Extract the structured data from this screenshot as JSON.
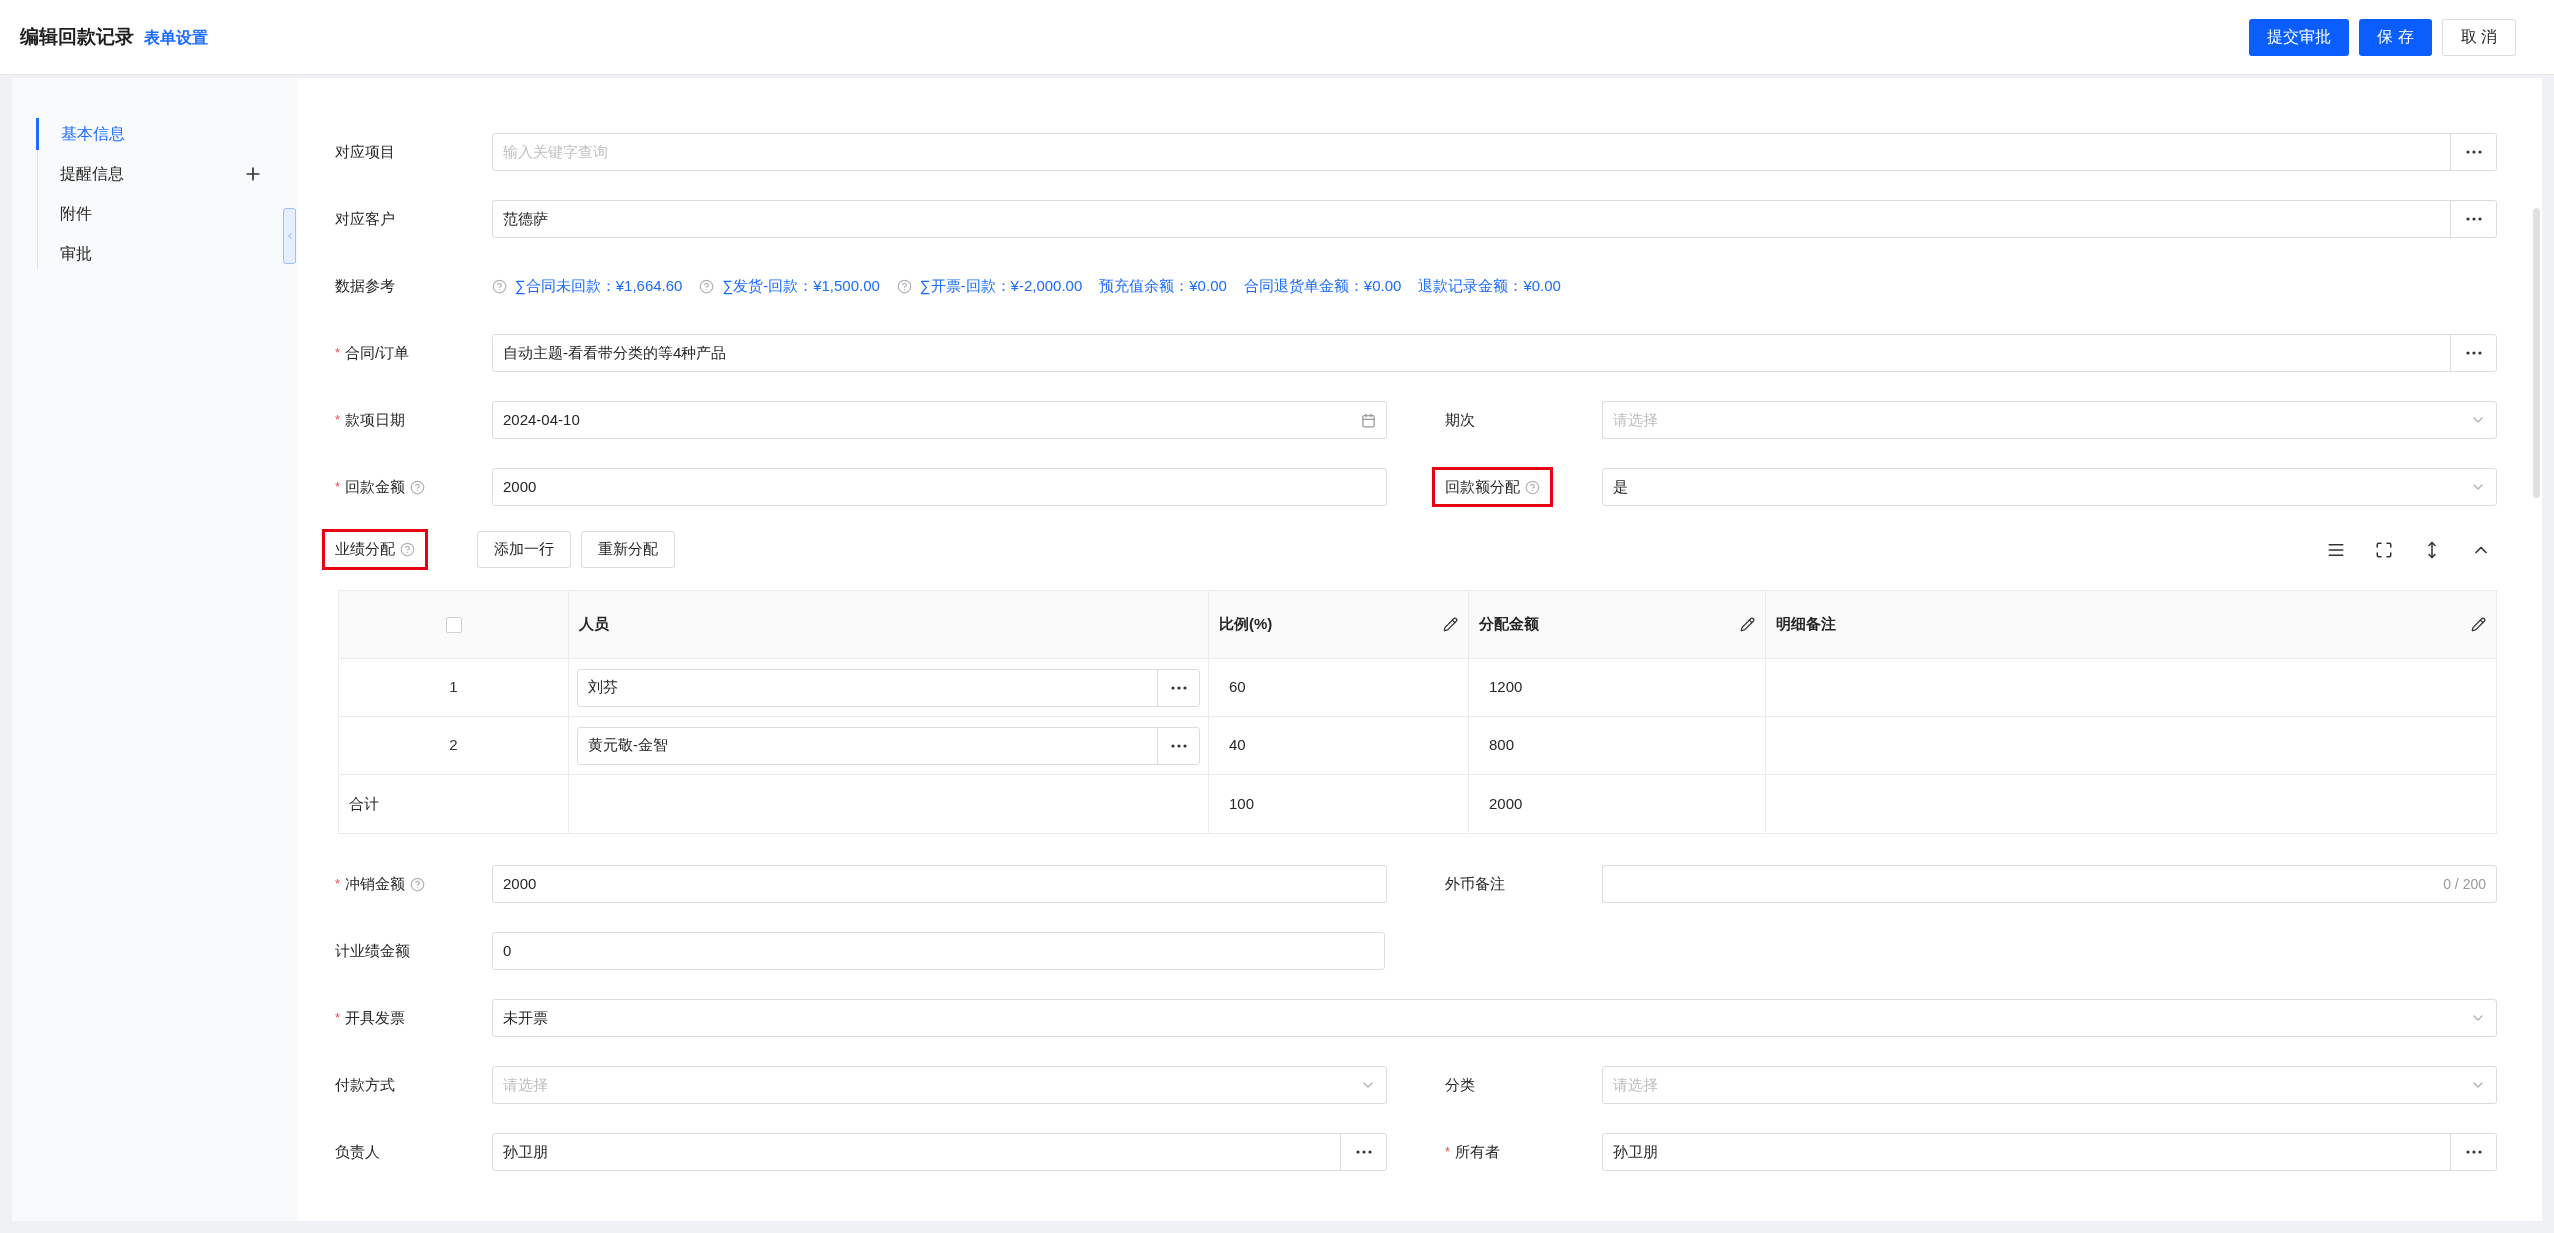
{
  "header": {
    "title": "编辑回款记录",
    "link": "表单设置",
    "buttons": [
      {
        "label": "提交审批",
        "kind": "primary"
      },
      {
        "label": "保 存",
        "kind": "primary"
      },
      {
        "label": "取 消",
        "kind": "default"
      }
    ]
  },
  "sidebar": {
    "items": [
      {
        "label": "基本信息",
        "selected": true,
        "addable": false
      },
      {
        "label": "提醒信息",
        "selected": false,
        "addable": true
      },
      {
        "label": "附件",
        "selected": false,
        "addable": false
      },
      {
        "label": "审批",
        "selected": false,
        "addable": false
      }
    ]
  },
  "form_top": [
    {
      "kind": "full",
      "fields": [
        {
          "label": "对应项目",
          "kind": "lookup",
          "placeholder": "输入关键字查询"
        }
      ]
    },
    {
      "kind": "full",
      "fields": [
        {
          "label": "对应客户",
          "kind": "lookup",
          "value": "范德萨"
        }
      ]
    },
    {
      "kind": "refs",
      "label": "数据参考",
      "refs": [
        {
          "text": "∑合同未回款：¥1,664.60",
          "help": true
        },
        {
          "text": "∑发货-回款：¥1,500.00",
          "help": true
        },
        {
          "text": "∑开票-回款：¥-2,000.00",
          "help": true
        },
        {
          "text": "预充值余额：¥0.00",
          "help": false
        },
        {
          "text": "合同退货单金额：¥0.00",
          "help": false
        },
        {
          "text": "退款记录金额：¥0.00",
          "help": false
        }
      ]
    },
    {
      "kind": "full",
      "fields": [
        {
          "label": "合同/订单",
          "required_mark": "*",
          "kind": "lookup",
          "value": "自动主题-看看带分类的等4种产品"
        }
      ]
    },
    {
      "kind": "split",
      "fields": [
        {
          "label": "款项日期",
          "required_mark": "*",
          "kind": "date",
          "value": "2024-04-10"
        },
        {
          "label": "期次",
          "kind": "select",
          "placeholder": "请选择"
        }
      ]
    },
    {
      "kind": "split",
      "fields": [
        {
          "label": "回款金额",
          "required_mark": "*",
          "help": true,
          "kind": "text",
          "value": "2000"
        },
        {
          "label": "回款额分配",
          "help": true,
          "highlighted": true,
          "kind": "select",
          "value": "是"
        }
      ]
    }
  ],
  "allocation": {
    "label": "业绩分配",
    "help": true,
    "highlighted": true,
    "buttons": [
      "添加一行",
      "重新分配"
    ],
    "table": {
      "select_all_checked": false,
      "columns": [
        {
          "label": "人员",
          "editable": false
        },
        {
          "label": "比例(%)",
          "editable": true
        },
        {
          "label": "分配金额",
          "editable": true
        },
        {
          "label": "明细备注",
          "editable": true
        }
      ],
      "rows": [
        {
          "index": "1",
          "person": "刘芬",
          "ratio": "60",
          "amount": "1200"
        },
        {
          "index": "2",
          "person": "黄元敬-金智",
          "ratio": "40",
          "amount": "800"
        }
      ],
      "total": {
        "label": "合计",
        "ratio": "100",
        "amount": "2000"
      }
    }
  },
  "form_bottom": [
    {
      "kind": "split",
      "fields": [
        {
          "label": "冲销金额",
          "required_mark": "*",
          "help": true,
          "kind": "text",
          "value": "2000"
        },
        {
          "label": "外币备注",
          "kind": "text",
          "counter": "0 / 200"
        }
      ]
    },
    {
      "kind": "half",
      "fields": [
        {
          "label": "计业绩金额",
          "kind": "text",
          "value": "0"
        }
      ]
    },
    {
      "kind": "full",
      "fields": [
        {
          "label": "开具发票",
          "required_mark": "*",
          "kind": "select",
          "value": "未开票"
        }
      ]
    },
    {
      "kind": "split",
      "fields": [
        {
          "label": "付款方式",
          "kind": "select",
          "placeholder": "请选择"
        },
        {
          "label": "分类",
          "kind": "select",
          "placeholder": "请选择"
        }
      ]
    },
    {
      "kind": "split",
      "fields": [
        {
          "label": "负责人",
          "kind": "lookup",
          "value": "孙卫朋"
        },
        {
          "label": "所有者",
          "required_mark": "*",
          "kind": "lookup",
          "value": "孙卫朋"
        }
      ]
    }
  ]
}
